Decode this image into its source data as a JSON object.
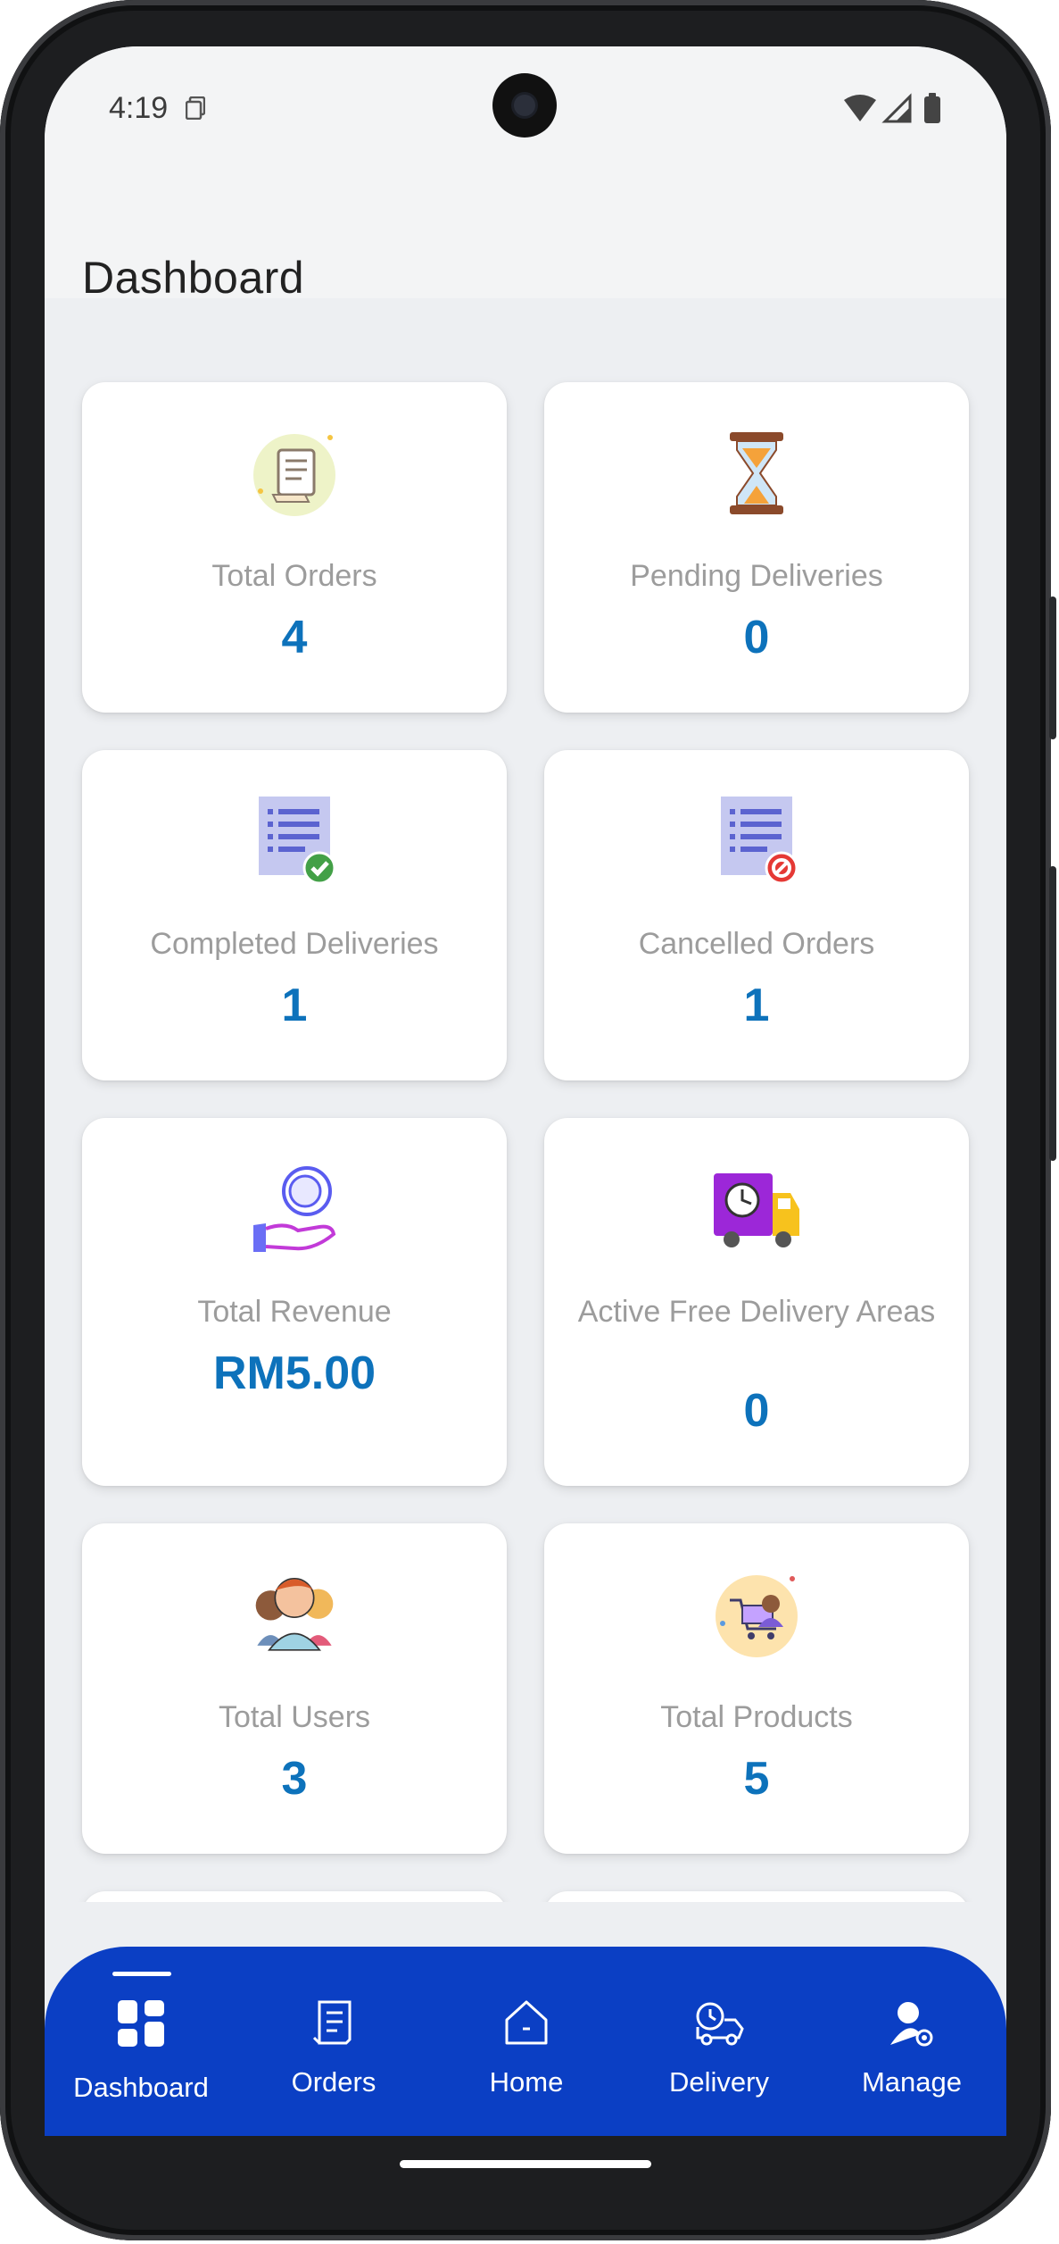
{
  "status_bar": {
    "time": "4:19"
  },
  "app_bar": {
    "title": "Dashboard"
  },
  "cards": [
    {
      "label": "Total Orders",
      "value": "4",
      "icon": "receipt-icon"
    },
    {
      "label": "Pending Deliveries",
      "value": "0",
      "icon": "hourglass-icon"
    },
    {
      "label": "Completed Deliveries",
      "value": "1",
      "icon": "list-check-icon"
    },
    {
      "label": "Cancelled Orders",
      "value": "1",
      "icon": "list-cancel-icon"
    },
    {
      "label": "Total Revenue",
      "value": "RM5.00",
      "icon": "coin-hand-icon"
    },
    {
      "label": "Active Free Delivery Areas",
      "value": "0",
      "icon": "delivery-truck-clock-icon"
    },
    {
      "label": "Total Users",
      "value": "3",
      "icon": "users-group-icon"
    },
    {
      "label": "Total Products",
      "value": "5",
      "icon": "shopping-cart-icon"
    }
  ],
  "bottom_nav": {
    "items": [
      {
        "label": "Dashboard",
        "icon": "dashboard-icon",
        "selected": true
      },
      {
        "label": "Orders",
        "icon": "orders-icon",
        "selected": false
      },
      {
        "label": "Home",
        "icon": "home-icon",
        "selected": false
      },
      {
        "label": "Delivery",
        "icon": "delivery-icon",
        "selected": false
      },
      {
        "label": "Manage",
        "icon": "manage-user-icon",
        "selected": false
      }
    ]
  },
  "colors": {
    "accent": "#0d72bb",
    "nav_background": "#0b3fc4",
    "label": "#9c9c9c"
  }
}
